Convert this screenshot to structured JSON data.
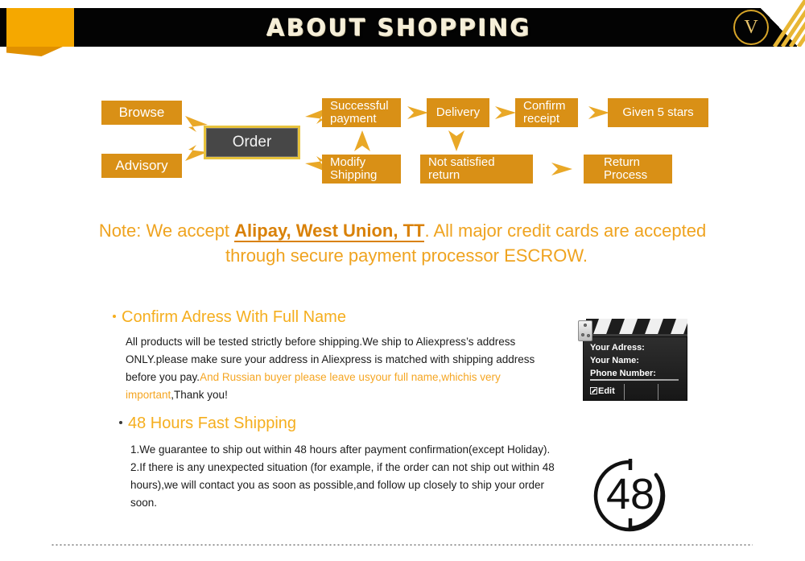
{
  "header": {
    "title": "ABOUT SHOPPING",
    "logo_letter": "V"
  },
  "flow": {
    "nodes": [
      {
        "id": "browse",
        "label": "Browse"
      },
      {
        "id": "advisory",
        "label": "Advisory"
      },
      {
        "id": "order",
        "label": "Order"
      },
      {
        "id": "successful",
        "label": "Successful payment"
      },
      {
        "id": "delivery",
        "label": "Delivery"
      },
      {
        "id": "confirm",
        "label": "Confirm receipt"
      },
      {
        "id": "stars",
        "label": "Given 5 stars"
      },
      {
        "id": "modify",
        "label": "Modify Shipping"
      },
      {
        "id": "notsat",
        "label": "Not satisfied return"
      },
      {
        "id": "return",
        "label": "Return Process"
      }
    ],
    "labels": {
      "browse": "Browse",
      "advisory": "Advisory",
      "order": "Order",
      "successful_1": "Successful",
      "successful_2": "payment",
      "delivery": "Delivery",
      "confirm_1": "Confirm",
      "confirm_2": "receipt",
      "stars": "Given 5 stars",
      "modify_1": "Modify",
      "modify_2": "Shipping",
      "notsat_1": "Not satisfied",
      "notsat_2": "return",
      "return_1": "Return",
      "return_2": "Process"
    },
    "colors": {
      "box": "#D99016",
      "order_bg": "#474747",
      "order_border": "#E8C33C",
      "arrow": "#E9A827"
    }
  },
  "note": {
    "prefix": "Note:  We accept ",
    "emphasis": "Alipay, West Union, TT",
    "line1_tail": ". All major credit cards are accepted",
    "line2": "through secure payment processor ESCROW."
  },
  "sections": [
    {
      "heading": "Confirm Adress With Full Name",
      "body_plain_1": "All products will be tested strictly before shipping.We ship to Aliexpress’s address ONLY.please make sure your address in Aliexpress is matched with shipping address before you pay.",
      "body_highlight": "And Russian buyer please leave usyour full name,whichis very important",
      "body_plain_2": ",Thank you!"
    },
    {
      "heading": "48 Hours Fast Shipping",
      "body_line_1": "1.We guarantee to ship out within 48 hours after payment confirmation(except Holiday).",
      "body_line_2": "2.If there is any unexpected situation (for example, if the order can not ship out within 48 hours),we will contact you as soon as possible,and follow up closely to ship your order soon."
    }
  ],
  "clapperboard": {
    "field_address": "Your Adress:",
    "field_name": "Your Name:",
    "field_phone": "Phone Number:",
    "edit_label": "Edit"
  },
  "clock": {
    "value": "48"
  },
  "colors": {
    "orange": "#D99016",
    "amber": "#F5A800",
    "note_text": "#EFA31F",
    "heading": "#F5AE1E",
    "highlight": "#F5A623",
    "header_bg": "#030303",
    "title_text": "#F6EFD9"
  }
}
